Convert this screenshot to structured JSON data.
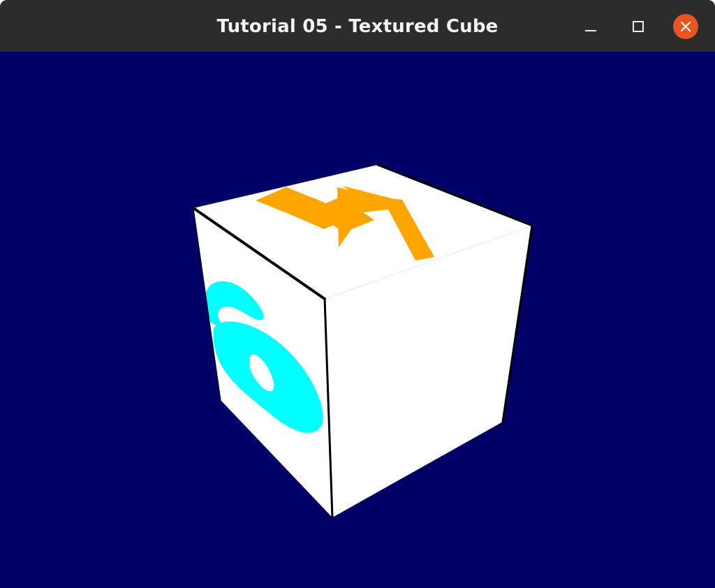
{
  "window": {
    "title": "Tutorial 05 - Textured Cube",
    "controls": {
      "minimize_icon": "minimize-icon",
      "maximize_icon": "maximize-icon",
      "close_icon": "close-icon"
    }
  },
  "scene": {
    "background_color": "#000066",
    "cube": {
      "face_color": "#ffffff",
      "edge_color": "#000000",
      "top_face_glyph": "4",
      "top_face_glyph_color": "#ffa500",
      "left_face_glyph": "6",
      "left_face_glyph_color": "#00ffff"
    }
  },
  "colors": {
    "titlebar": "#2c2c2c",
    "title_text": "#f2f2f2",
    "close_button": "#e95420"
  }
}
